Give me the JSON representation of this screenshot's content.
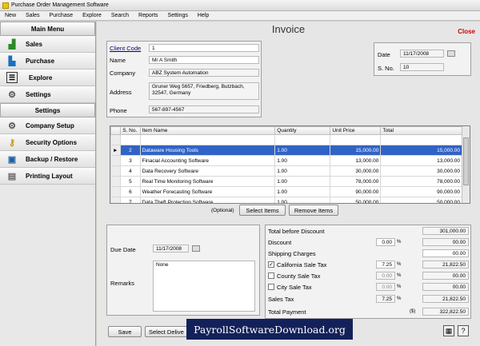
{
  "app": {
    "title": "Purchase Order Management Software"
  },
  "menu": [
    "New",
    "Sales",
    "Purchase",
    "Explore",
    "Search",
    "Reports",
    "Settings",
    "Help"
  ],
  "sidebar": {
    "main_menu_title": "Main Menu",
    "main_items": [
      "Sales",
      "Purchase",
      "Explore",
      "Settings"
    ],
    "settings_title": "Settings",
    "settings_items": [
      "Company Setup",
      "Security Options",
      "Backup / Restore",
      "Printing Layout"
    ]
  },
  "invoice": {
    "title": "Invoice",
    "close_label": "Close",
    "client_code_label": "Client Code",
    "client_code": "1",
    "name_label": "Name",
    "name": "Mr A Smith",
    "company_label": "Company",
    "company": "ABZ System Automation",
    "address_label": "Address",
    "address": "Gruner Weg 5657, Friedberg, Butzbach, 32547, Germany",
    "phone_label": "Phone",
    "phone": "567-897-4567",
    "date_label": "Date",
    "date": "11/17/2008",
    "sno_label": "S. No.",
    "sno": "10"
  },
  "items_table": {
    "headers": [
      "S. No.",
      "Item Name",
      "Quantity",
      "Unit Price",
      "Total"
    ],
    "rows": [
      {
        "sno": "",
        "name": "",
        "qty": "",
        "price": "",
        "total": ""
      },
      {
        "sno": "2",
        "name": "Dataware Housing Tools",
        "qty": "1.00",
        "price": "15,000.00",
        "total": "15,000.00"
      },
      {
        "sno": "3",
        "name": "Finacial Accounting Software",
        "qty": "1.00",
        "price": "13,000.00",
        "total": "13,000.00"
      },
      {
        "sno": "4",
        "name": "Data Recovery Software",
        "qty": "1.00",
        "price": "30,000.00",
        "total": "30,000.00"
      },
      {
        "sno": "5",
        "name": "Real Time Monitoring Software",
        "qty": "1.00",
        "price": "78,000.00",
        "total": "78,000.00"
      },
      {
        "sno": "6",
        "name": "Weather Forecasting Software",
        "qty": "1.00",
        "price": "90,000.00",
        "total": "90,000.00"
      },
      {
        "sno": "7",
        "name": "Data Theft Protection Software",
        "qty": "1.00",
        "price": "50,000.00",
        "total": "50,000.00"
      }
    ]
  },
  "item_buttons": {
    "optional_label": "(Optional)",
    "select": "Select Items",
    "remove": "Remove Items"
  },
  "due": {
    "due_date_label": "Due Date",
    "due_date": "11/17/2008",
    "remarks_label": "Remarks",
    "remarks": "None"
  },
  "totals": {
    "total_before_discount_label": "Total before Discount",
    "total_before_discount": "301,000.00",
    "discount_label": "Discount",
    "discount_pct": "0.00",
    "discount_amount": "00.00",
    "shipping_label": "Shipping Charges",
    "shipping": "00.00",
    "ca_tax_label": "California Sale Tax",
    "ca_tax_pct": "7.25",
    "ca_tax_amount": "21,822.50",
    "county_tax_label": "County Sale Tax",
    "county_tax_pct": "0.00",
    "county_tax_amount": "00.00",
    "city_tax_label": "City Sale Tax",
    "city_tax_pct": "0.00",
    "city_tax_amount": "00.00",
    "sales_tax_label": "Sales Tax",
    "sales_tax_pct": "7.25",
    "sales_tax_amount": "21,822.50",
    "total_payment_label": "Total Payment",
    "currency": "($)",
    "total_payment": "322,822.50",
    "pct_sign": "%"
  },
  "footer": {
    "save": "Save",
    "select_delivery": "Select Delive"
  },
  "watermark": "PayrollSoftwareDownload.org"
}
